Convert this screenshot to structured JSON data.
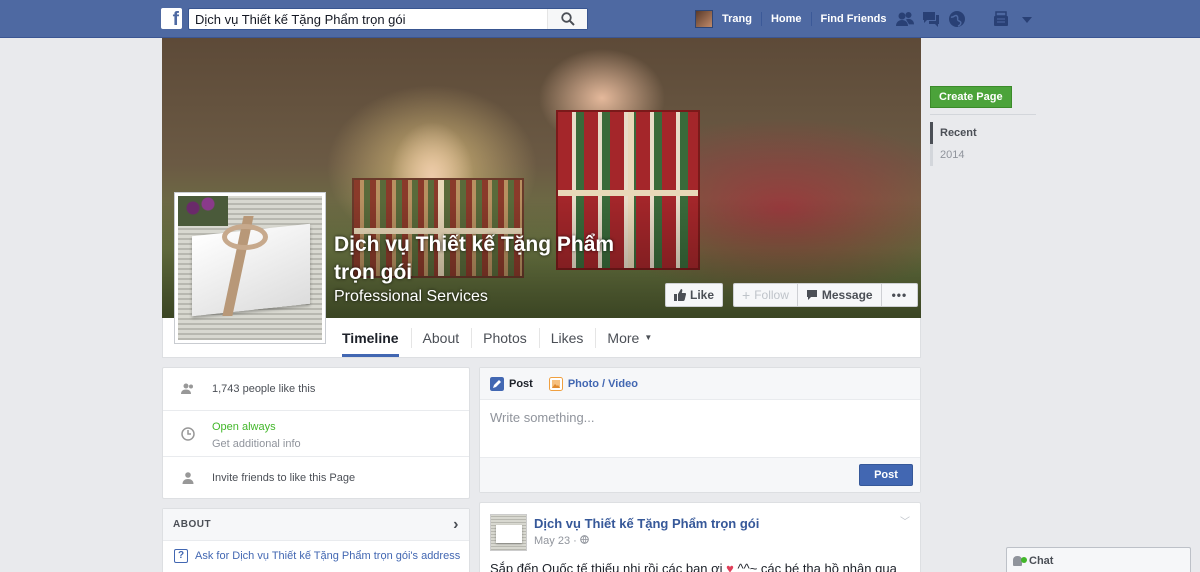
{
  "topbar": {
    "logo": "f",
    "search_value": "Dịch vụ Thiết kế Tặng Phẩm trọn gói",
    "user_name": "Trang",
    "home_label": "Home",
    "find_friends_label": "Find Friends",
    "icons": [
      "friend-requests-icon",
      "messages-icon",
      "notifications-icon",
      "privacy-shortcuts-icon",
      "account-menu-icon"
    ]
  },
  "page": {
    "name": "Dịch vụ Thiết kế Tặng Phẩm trọn gói",
    "category": "Professional Services"
  },
  "cover_actions": {
    "like": "Like",
    "follow": "Follow",
    "message": "Message",
    "more": "•••"
  },
  "tabs": [
    {
      "label": "Timeline",
      "active": true
    },
    {
      "label": "About"
    },
    {
      "label": "Photos"
    },
    {
      "label": "Likes"
    },
    {
      "label": "More"
    }
  ],
  "right_rail": {
    "create_page": "Create Page",
    "years": [
      "Recent",
      "2014"
    ]
  },
  "info": {
    "likes": "1,743 people like this",
    "hours_status": "Open always",
    "hours_more": "Get additional info",
    "invite": "Invite friends to like this Page"
  },
  "about": {
    "heading": "ABOUT",
    "ask_address": "Ask for Dịch vụ Thiết kế Tặng Phẩm trọn gói's address"
  },
  "composer": {
    "post_tab": "Post",
    "photo_tab": "Photo / Video",
    "placeholder": "Write something...",
    "post_button": "Post"
  },
  "feed_post": {
    "author": "Dịch vụ Thiết kế Tặng Phẩm trọn gói",
    "time": "May 23 ·",
    "text_before": "Sắp đến Quốc tế thiếu nhi rồi các bạn ơi ",
    "text_after": " ^^~ các bé tha hồ nhận qua"
  },
  "chat": {
    "label": "Chat"
  },
  "colors": {
    "topbar": "#4e69a2",
    "link": "#365899",
    "create_page": "#4ba33a",
    "post_button": "#4267b2",
    "open_status": "#42b72a"
  }
}
